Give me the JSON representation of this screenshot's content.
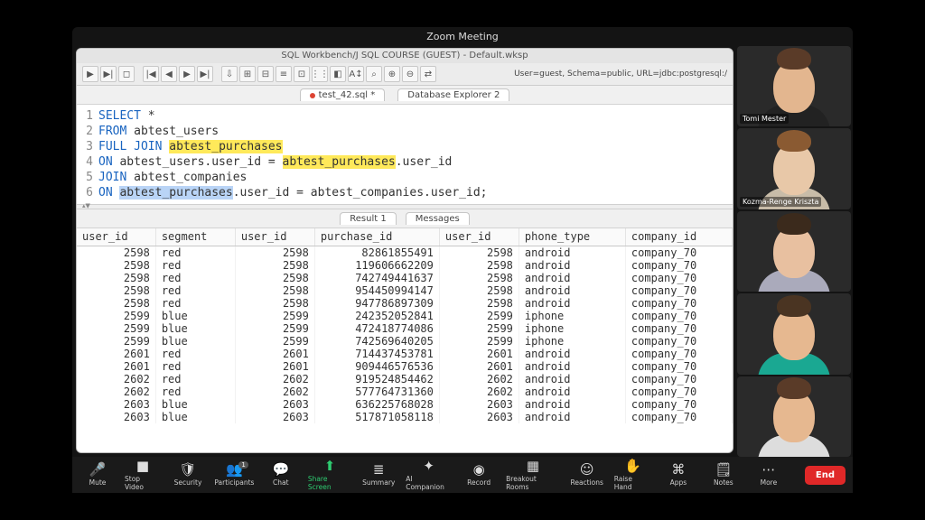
{
  "zoom": {
    "title": "Zoom Meeting",
    "controls": [
      {
        "key": "mute",
        "label": "Mute",
        "icon": "🎤"
      },
      {
        "key": "stop-video",
        "label": "Stop Video",
        "icon": "■"
      },
      {
        "key": "security",
        "label": "Security",
        "icon": "🛡"
      },
      {
        "key": "participants",
        "label": "Participants",
        "icon": "👥",
        "badge": "1"
      },
      {
        "key": "chat",
        "label": "Chat",
        "icon": "💬"
      },
      {
        "key": "share-screen",
        "label": "Share Screen",
        "icon": "⬆",
        "green": true
      },
      {
        "key": "summary",
        "label": "Summary",
        "icon": "≣"
      },
      {
        "key": "ai-companion",
        "label": "AI Companion",
        "icon": "✦"
      },
      {
        "key": "record",
        "label": "Record",
        "icon": "◉"
      },
      {
        "key": "breakout",
        "label": "Breakout Rooms",
        "icon": "▦"
      },
      {
        "key": "reactions",
        "label": "Reactions",
        "icon": "☺"
      },
      {
        "key": "raise-hand",
        "label": "Raise Hand",
        "icon": "✋"
      },
      {
        "key": "apps",
        "label": "Apps",
        "icon": "⌘"
      },
      {
        "key": "notes",
        "label": "Notes",
        "icon": "🗒"
      },
      {
        "key": "more",
        "label": "More",
        "icon": "⋯"
      }
    ],
    "end": "End",
    "participants_list": [
      {
        "name": "Tomi Mester"
      },
      {
        "name": "Kozma-Renge Kriszta"
      },
      {
        "name": ""
      },
      {
        "name": ""
      },
      {
        "name": ""
      }
    ]
  },
  "app": {
    "title": "SQL Workbench/J SQL COURSE (GUEST) - Default.wksp",
    "conn": "User=guest, Schema=public, URL=jdbc:postgresql:/",
    "editor_tabs": {
      "file": "test_42.sql *",
      "other": "Database Explorer 2"
    },
    "result_tabs": {
      "res": "Result 1",
      "msg": "Messages"
    },
    "sql_lines": [
      {
        "n": "1",
        "pre": "",
        "kw": "SELECT",
        "rest": " *"
      },
      {
        "n": "2",
        "pre": "",
        "kw": "FROM",
        "rest": " abtest_users"
      },
      {
        "n": "3",
        "pre": "",
        "kw": "FULL JOIN",
        "rest": " ",
        "hl": "abtest_purchases"
      },
      {
        "n": "4",
        "pre": "",
        "kw": "ON",
        "rest": " abtest_users.user_id = ",
        "hl": "abtest_purchases",
        "tail": ".user_id"
      },
      {
        "n": "5",
        "pre": "",
        "kw": "JOIN",
        "rest": " abtest_companies"
      },
      {
        "n": "6",
        "pre": "",
        "kw": "ON",
        "rest": " ",
        "sel": "abtest_purchases",
        "tail": ".user_id = abtest_companies.user_id;"
      }
    ],
    "columns": [
      "user_id",
      "segment",
      "user_id",
      "purchase_id",
      "user_id",
      "phone_type",
      "company_id"
    ],
    "rows": [
      [
        "2598",
        "red",
        "2598",
        "82861855491",
        "2598",
        "android",
        "company_70"
      ],
      [
        "2598",
        "red",
        "2598",
        "119606662209",
        "2598",
        "android",
        "company_70"
      ],
      [
        "2598",
        "red",
        "2598",
        "742749441637",
        "2598",
        "android",
        "company_70"
      ],
      [
        "2598",
        "red",
        "2598",
        "954450994147",
        "2598",
        "android",
        "company_70"
      ],
      [
        "2598",
        "red",
        "2598",
        "947786897309",
        "2598",
        "android",
        "company_70"
      ],
      [
        "2599",
        "blue",
        "2599",
        "242352052841",
        "2599",
        "iphone",
        "company_70"
      ],
      [
        "2599",
        "blue",
        "2599",
        "472418774086",
        "2599",
        "iphone",
        "company_70"
      ],
      [
        "2599",
        "blue",
        "2599",
        "742569640205",
        "2599",
        "iphone",
        "company_70"
      ],
      [
        "2601",
        "red",
        "2601",
        "714437453781",
        "2601",
        "android",
        "company_70"
      ],
      [
        "2601",
        "red",
        "2601",
        "909446576536",
        "2601",
        "android",
        "company_70"
      ],
      [
        "2602",
        "red",
        "2602",
        "919524854462",
        "2602",
        "android",
        "company_70"
      ],
      [
        "2602",
        "red",
        "2602",
        "577764731360",
        "2602",
        "android",
        "company_70"
      ],
      [
        "2603",
        "blue",
        "2603",
        "636225768028",
        "2603",
        "android",
        "company_70"
      ],
      [
        "2603",
        "blue",
        "2603",
        "517871058118",
        "2603",
        "android",
        "company_70"
      ]
    ]
  }
}
